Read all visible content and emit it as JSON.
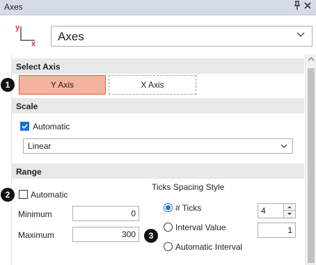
{
  "window": {
    "title": "Axes",
    "pin_icon": "pin-icon",
    "close_icon": "close-icon"
  },
  "axes_selector": {
    "icon": "axes-icon",
    "icon_y": "y",
    "icon_x": "x",
    "value": "Axes"
  },
  "sections": {
    "select_axis": "Select Axis",
    "scale": "Scale",
    "range": "Range"
  },
  "axis_buttons": {
    "y": "Y Axis",
    "x": "X Axis"
  },
  "badges": {
    "one": "1",
    "two": "2",
    "three": "3"
  },
  "scale": {
    "automatic_label": "Automatic",
    "automatic_checked": true,
    "type_value": "Linear"
  },
  "range": {
    "automatic_label": "Automatic",
    "automatic_checked": false,
    "minimum_label": "Minimum",
    "minimum_value": "0",
    "maximum_label": "Maximum",
    "maximum_value": "300"
  },
  "ticks": {
    "heading": "Ticks Spacing Style",
    "num_ticks_label": "# Ticks",
    "num_ticks_value": "4",
    "interval_label": "Interval Value",
    "interval_value": "1",
    "auto_interval_label": "Automatic Interval",
    "selected": "num_ticks"
  },
  "colors": {
    "accent": "#1e6fd0",
    "selected_axis_fill": "#f4b39f",
    "selected_axis_border": "#e05b3f",
    "axis_icon_red": "#e03030"
  }
}
